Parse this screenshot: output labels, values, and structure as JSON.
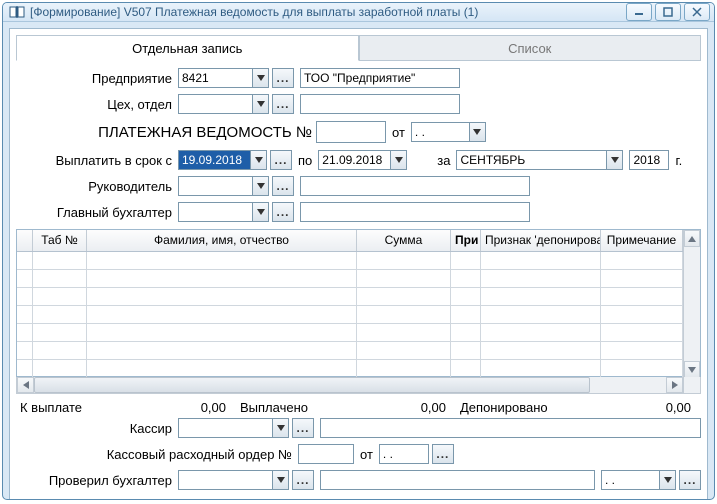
{
  "window": {
    "title": "[Формирование] V507 Платежная ведомость для выплаты заработной платы (1)"
  },
  "tabs": {
    "record": "Отдельная запись",
    "list": "Список"
  },
  "labels": {
    "enterprise": "Предприятие",
    "dept": "Цех, отдел",
    "doc_title": "ПЛАТЕЖНАЯ ВЕДОМОСТЬ №",
    "from": "от",
    "pay_by": "Выплатить в срок с",
    "to": "по",
    "for": "за",
    "year_suffix": "г.",
    "manager": "Руководитель",
    "chief_acc": "Главный бухгалтер",
    "to_pay": "К выплате",
    "paid": "Выплачено",
    "deposited": "Депонировано",
    "cashier": "Кассир",
    "cash_order": "Кассовый расходный ордер №",
    "cash_order_from": "от",
    "checked_by": "Проверил бухгалтер"
  },
  "fields": {
    "enterprise_code": "8421",
    "enterprise_name": "ТОО \"Предприятие\"",
    "dept_code": "",
    "dept_name": "",
    "doc_no": "",
    "doc_date": " .  .",
    "date_from": "19.09.2018",
    "date_to": "21.09.2018",
    "month": "СЕНТЯБРЬ",
    "year": "2018",
    "manager_code": "",
    "manager_name": "",
    "chief_code": "",
    "chief_name": "",
    "to_pay": "0,00",
    "paid": "0,00",
    "deposited": "0,00",
    "cashier_code": "",
    "cashier_name": "",
    "cash_order_no": "",
    "cash_order_date": " .  .",
    "checked_code": "",
    "checked_name": "",
    "checked_date": " .  ."
  },
  "table": {
    "cols": {
      "tab": "Таб №",
      "fio": "Фамилия, имя, отчество",
      "sum": "Сумма",
      "pri": "При",
      "depflag": "Признак 'депонирова",
      "note": "Примечание"
    }
  }
}
